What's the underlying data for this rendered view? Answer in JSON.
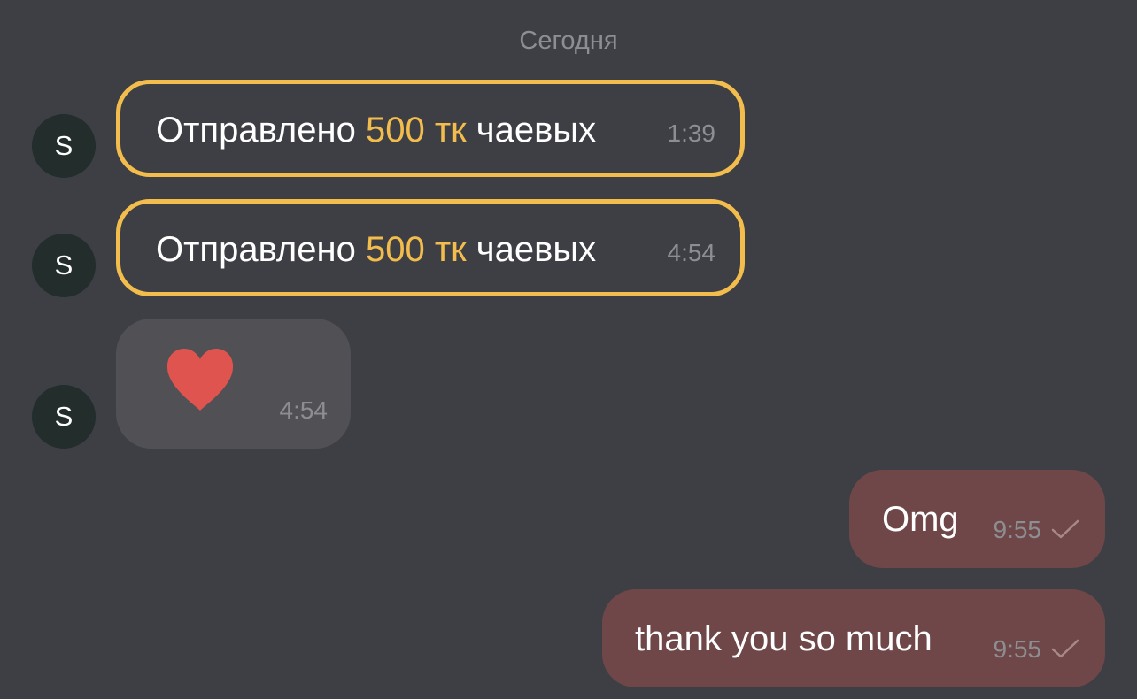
{
  "date_separator": "Сегодня",
  "avatar_letter": "S",
  "colors": {
    "background": "#3e3f44",
    "tip_accent": "#f2bd4c",
    "incoming_bubble": "#505055",
    "outgoing_bubble": "#6f4748",
    "avatar_bg": "#232d2b",
    "heart": "#e0544f",
    "meta_text": "#8d8e93"
  },
  "messages": [
    {
      "type": "tip",
      "prefix": "Отправлено",
      "amount": "500 тк",
      "suffix": "чаевых",
      "time": "1:39"
    },
    {
      "type": "tip",
      "prefix": "Отправлено",
      "amount": "500 тк",
      "suffix": "чаевых",
      "time": "4:54"
    },
    {
      "type": "sticker",
      "icon": "heart-icon",
      "time": "4:54"
    },
    {
      "type": "outgoing",
      "text": "Omg",
      "time": "9:55",
      "status_icon": "check-icon"
    },
    {
      "type": "outgoing",
      "text": "thank you so much",
      "time": "9:55",
      "status_icon": "check-icon"
    }
  ]
}
